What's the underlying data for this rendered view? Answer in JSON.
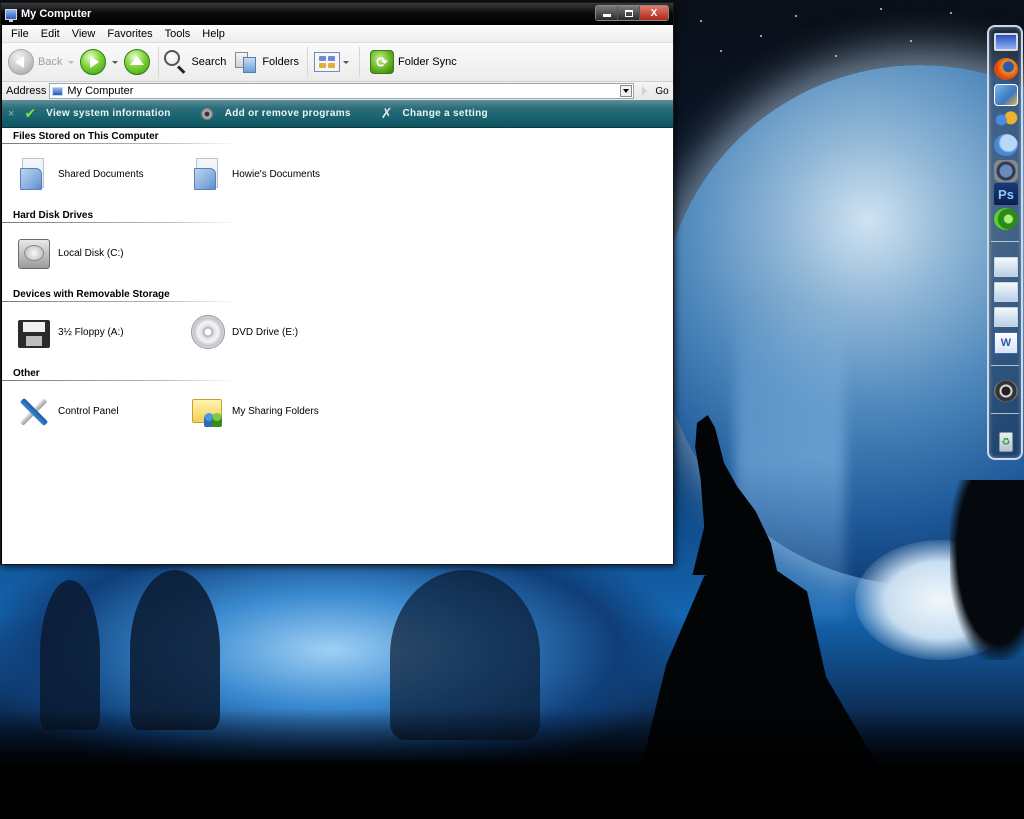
{
  "window": {
    "title": "My Computer",
    "caption_buttons": {
      "minimize": "minimize",
      "maximize": "maximize",
      "close": "X"
    }
  },
  "menubar": [
    "File",
    "Edit",
    "View",
    "Favorites",
    "Tools",
    "Help"
  ],
  "toolbar": {
    "back_label": "Back",
    "search_label": "Search",
    "folders_label": "Folders",
    "folder_sync_label": "Folder Sync"
  },
  "address": {
    "label": "Address",
    "value": "My Computer",
    "go_label": "Go"
  },
  "tasks": {
    "close_glyph": "×",
    "items": [
      {
        "label": "View system information",
        "icon": "check-icon"
      },
      {
        "label": "Add or remove programs",
        "icon": "cd-icon"
      },
      {
        "label": "Change a setting",
        "icon": "wrench-icon"
      }
    ]
  },
  "groups": [
    {
      "header": "Files Stored on This Computer",
      "items": [
        {
          "label": "Shared Documents",
          "icon": "shared-documents-icon"
        },
        {
          "label": "Howie's Documents",
          "icon": "user-documents-icon"
        }
      ]
    },
    {
      "header": "Hard Disk Drives",
      "items": [
        {
          "label": "Local Disk (C:)",
          "icon": "hard-disk-icon"
        }
      ]
    },
    {
      "header": "Devices with Removable Storage",
      "items": [
        {
          "label": "3½ Floppy (A:)",
          "icon": "floppy-icon"
        },
        {
          "label": "DVD Drive (E:)",
          "icon": "dvd-drive-icon"
        }
      ]
    },
    {
      "header": "Other",
      "items": [
        {
          "label": "Control Panel",
          "icon": "control-panel-icon"
        },
        {
          "label": "My Sharing Folders",
          "icon": "sharing-folders-icon"
        }
      ]
    }
  ],
  "dock": {
    "items": [
      "my-computer",
      "firefox",
      "photo-gallery",
      "msn-messenger",
      "aim",
      "trash-drum",
      "photoshop",
      "green-app",
      "documents-linux",
      "documents-music",
      "documents-pictures",
      "word",
      "ring-app",
      "recycle-bin"
    ],
    "ps_label": "Ps",
    "word_label": "W"
  },
  "colors": {
    "taskbar_teal": "#1b6471",
    "titlebar": "#000000",
    "close_red": "#b0281a"
  }
}
